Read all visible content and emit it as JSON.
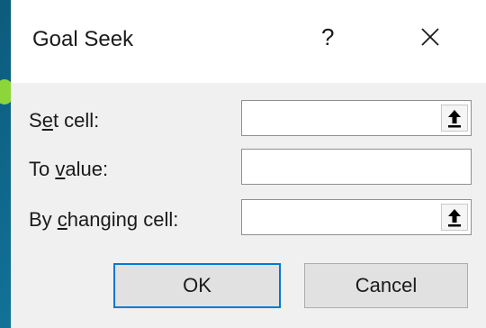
{
  "dialog": {
    "title": "Goal Seek",
    "help_label": "?",
    "close_icon": "close-icon"
  },
  "fields": {
    "set_cell": {
      "label_pre": "S",
      "label_mnemonic": "e",
      "label_post": "t cell:",
      "value": "",
      "ref_icon": "collapse-dialog-arrow-icon"
    },
    "to_value": {
      "label_pre": "To ",
      "label_mnemonic": "v",
      "label_post": "alue:",
      "value": ""
    },
    "by_changing_cell": {
      "label_pre": "By ",
      "label_mnemonic": "c",
      "label_post": "hanging cell:",
      "value": "",
      "ref_icon": "collapse-dialog-arrow-icon"
    }
  },
  "buttons": {
    "ok_label": "OK",
    "cancel_label": "Cancel"
  },
  "colors": {
    "background": "#0f6486",
    "accent_dot": "#8dd63a",
    "dialog_bg": "#f0f0f0",
    "focus_border": "#0078d7"
  }
}
